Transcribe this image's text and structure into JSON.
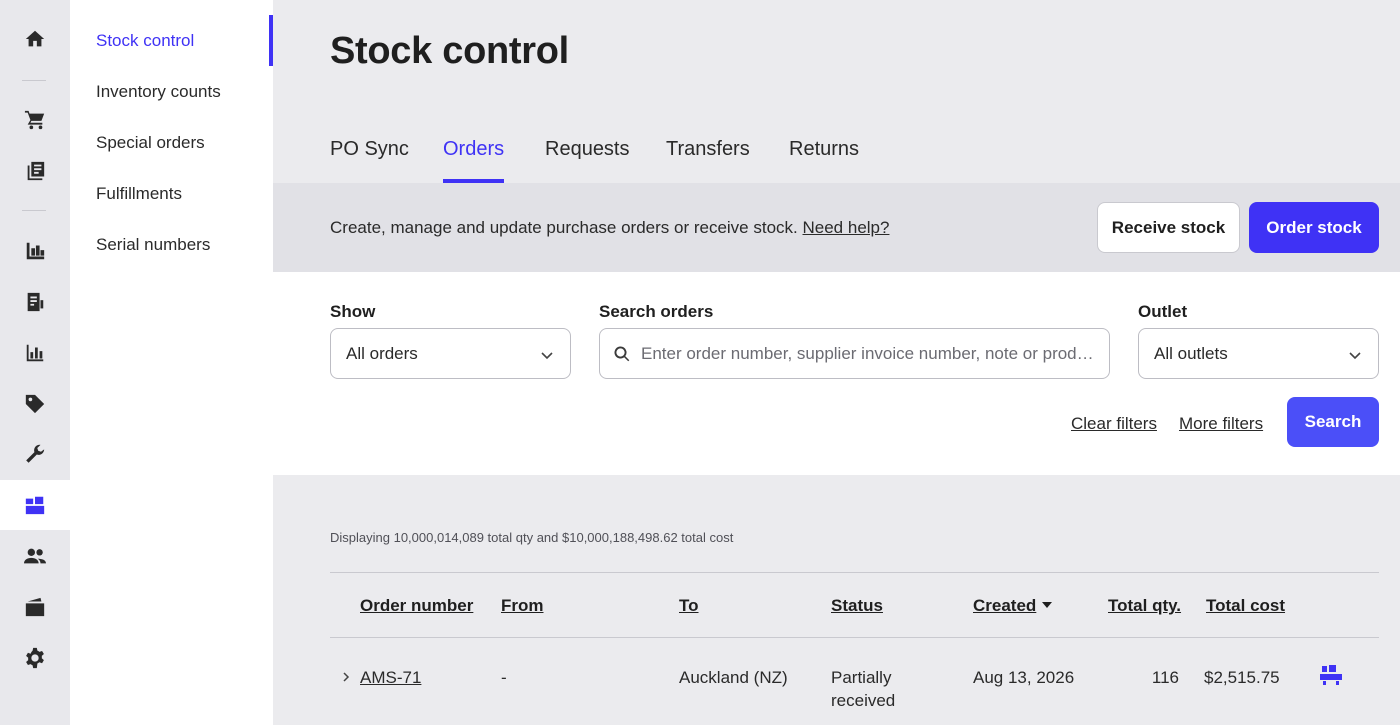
{
  "rail": {
    "items": [
      {
        "icon": "home-icon"
      },
      {
        "icon": "cart-icon"
      },
      {
        "icon": "sales-ledger-icon"
      },
      {
        "icon": "catalog-icon"
      },
      {
        "icon": "register-icon"
      },
      {
        "icon": "reports-icon"
      },
      {
        "icon": "tag-icon"
      },
      {
        "icon": "wrench-icon"
      },
      {
        "icon": "inventory-boxes-icon"
      },
      {
        "icon": "customers-icon"
      },
      {
        "icon": "wallet-icon"
      },
      {
        "icon": "settings-gear-icon"
      }
    ],
    "active_color": "#3f32f5"
  },
  "subnav": {
    "items": [
      {
        "label": "Stock control"
      },
      {
        "label": "Inventory counts"
      },
      {
        "label": "Special orders"
      },
      {
        "label": "Fulfillments"
      },
      {
        "label": "Serial numbers"
      }
    ]
  },
  "page": {
    "title": "Stock control"
  },
  "tabs": [
    {
      "label": "PO Sync"
    },
    {
      "label": "Orders"
    },
    {
      "label": "Requests"
    },
    {
      "label": "Transfers"
    },
    {
      "label": "Returns"
    }
  ],
  "banner": {
    "text": "Create, manage and update purchase orders or receive stock.",
    "help_link": "Need help?",
    "receive_button": "Receive stock",
    "order_button": "Order stock"
  },
  "filters": {
    "show_label": "Show",
    "show_value": "All orders",
    "search_label": "Search orders",
    "search_placeholder": "Enter order number, supplier invoice number, note or prod…",
    "outlet_label": "Outlet",
    "outlet_value": "All outlets",
    "clear_link": "Clear filters",
    "more_link": "More filters",
    "search_button": "Search"
  },
  "summary": "Displaying 10,000,014,089 total qty and $10,000,188,498.62 total cost",
  "table": {
    "headers": {
      "order_number": "Order number",
      "from": "From",
      "to": "To",
      "status": "Status",
      "created": "Created",
      "total_qty": "Total qty.",
      "total_cost": "Total cost"
    },
    "rows": [
      {
        "order_number": "AMS-71",
        "from": "-",
        "to": "Auckland (NZ)",
        "status_line1": "Partially",
        "status_line2": "received",
        "created": "Aug 13, 2026",
        "total_qty": "116",
        "total_cost": "$2,515.75"
      }
    ]
  },
  "colors": {
    "accent": "#3f32f5",
    "search_button": "#4b4ff8"
  }
}
